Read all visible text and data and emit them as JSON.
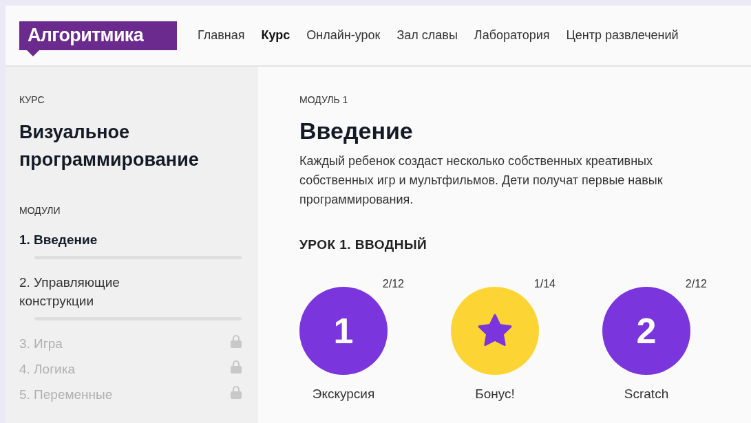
{
  "header": {
    "logo": "Алгоритмика",
    "nav": [
      {
        "label": "Главная",
        "selected": false
      },
      {
        "label": "Курс",
        "selected": true
      },
      {
        "label": "Онлайн-урок",
        "selected": false
      },
      {
        "label": "Зал славы",
        "selected": false
      },
      {
        "label": "Лаборатория",
        "selected": false
      },
      {
        "label": "Центр развлечений",
        "selected": false
      }
    ]
  },
  "sidebar": {
    "course_label": "КУРС",
    "course_title": "Визуальное программирование",
    "modules_label": "МОДУЛИ",
    "modules": [
      {
        "label": "1. Введение",
        "selected": true,
        "locked": false
      },
      {
        "label": "2. Управляющие конструкции",
        "selected": false,
        "locked": false
      },
      {
        "label": "3. Игра",
        "selected": false,
        "locked": true
      },
      {
        "label": "4. Логика",
        "selected": false,
        "locked": true
      },
      {
        "label": "5. Переменные",
        "selected": false,
        "locked": true
      }
    ]
  },
  "main": {
    "module_label": "МОДУЛЬ 1",
    "title": "Введение",
    "description_lines": [
      "Каждый ребенок создаст несколько собственных креативных",
      "собственных игр и мультфильмов. Дети получат первые навык",
      "программирования."
    ],
    "lesson_title": "УРОК 1. ВВОДНЫЙ",
    "tasks": [
      {
        "kind": "number",
        "symbol": "1",
        "counter": "2/12",
        "label": "Экскурсия",
        "color": "#7b35dd"
      },
      {
        "kind": "star",
        "counter": "1/14",
        "label": "Бонус!",
        "color": "#fcd535"
      },
      {
        "kind": "number",
        "symbol": "2",
        "counter": "2/12",
        "label": "Scratch",
        "color": "#7b35dd"
      }
    ]
  }
}
